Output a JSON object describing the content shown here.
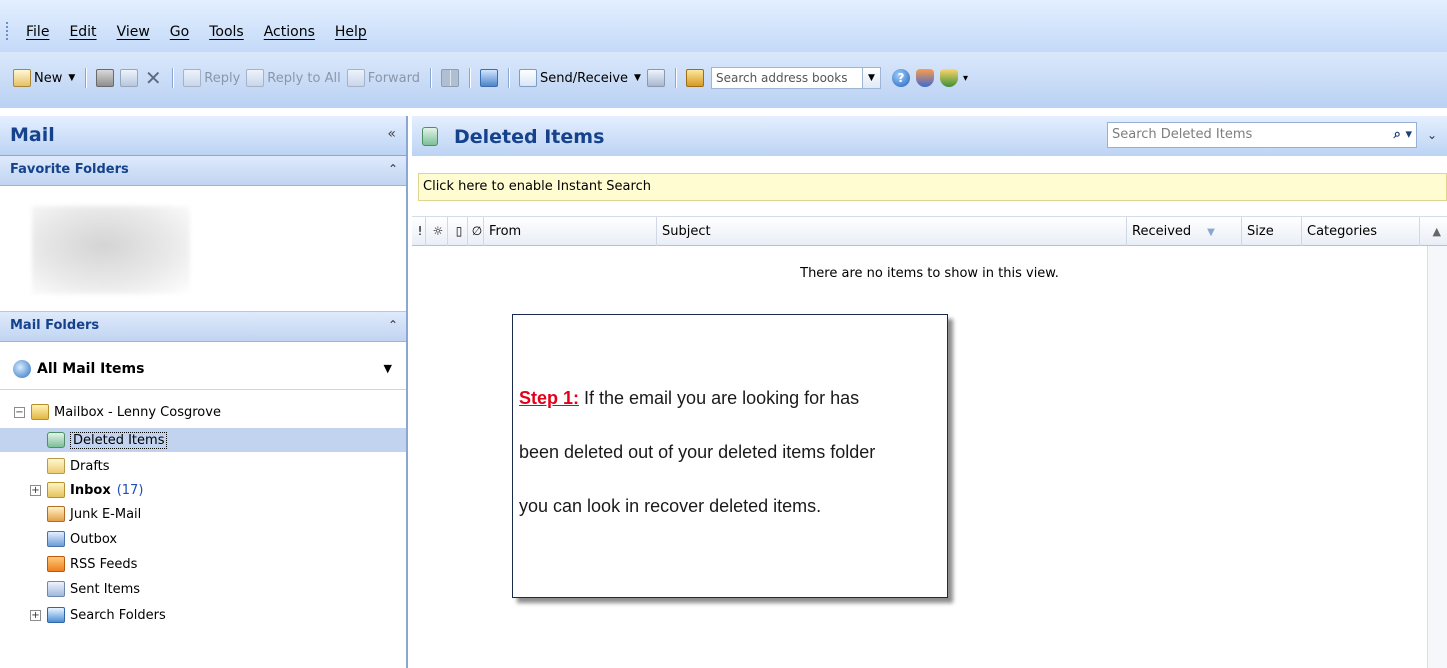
{
  "menu": {
    "items": [
      "File",
      "Edit",
      "View",
      "Go",
      "Tools",
      "Actions",
      "Help"
    ]
  },
  "toolbar": {
    "new_label": "New",
    "reply_label": "Reply",
    "reply_all_label": "Reply to All",
    "forward_label": "Forward",
    "send_receive_label": "Send/Receive",
    "address_search_placeholder": "Search address books"
  },
  "nav": {
    "title": "Mail",
    "collapse_glyph": "«",
    "favorite_folders_title": "Favorite Folders",
    "mail_folders_title": "Mail Folders",
    "all_mail_items_label": "All Mail Items",
    "mailbox_label": "Mailbox - Lenny Cosgrove",
    "folders": {
      "deleted": "Deleted Items",
      "drafts": "Drafts",
      "inbox": "Inbox",
      "inbox_count": "(17)",
      "junk": "Junk E-Mail",
      "outbox": "Outbox",
      "rss": "RSS Feeds",
      "sent": "Sent Items",
      "search": "Search Folders"
    }
  },
  "content": {
    "title": "Deleted Items",
    "search_placeholder": "Search Deleted Items",
    "instant_search_text": "Click here to enable Instant Search",
    "columns": {
      "from": "From",
      "subject": "Subject",
      "received": "Received",
      "size": "Size",
      "categories": "Categories"
    },
    "empty_message": "There are no items to show in this view."
  },
  "callout": {
    "step_label": "Step 1:",
    "line1": " If the email you are looking for has",
    "line2": "been deleted out of your deleted items folder",
    "line3": "you can look in recover deleted items."
  },
  "icons": {
    "new": "new-mail-icon",
    "print": "print-icon",
    "move": "move-to-folder-icon",
    "delete": "delete-icon",
    "reply": "reply-icon",
    "reply_all": "reply-all-icon",
    "forward": "forward-icon",
    "send_receive": "send-receive-icon",
    "address_book": "address-book-icon",
    "help": "help-icon"
  },
  "colors": {
    "header_text": "#15428b",
    "step_label": "#e3001b",
    "selected_row": "#c1d3ef",
    "instant_bar": "#fffcd1"
  }
}
